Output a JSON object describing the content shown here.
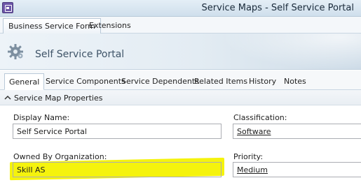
{
  "window": {
    "title": "Service Maps - Self Service Portal"
  },
  "form_tabs": [
    {
      "label": "Business Service Form",
      "active": true
    },
    {
      "label": "Extensions",
      "active": false
    }
  ],
  "banner": {
    "title": "Self Service Portal",
    "icon": "gear-icon"
  },
  "section_tabs": [
    {
      "label": "General",
      "active": true
    },
    {
      "label": "Service Components",
      "active": false
    },
    {
      "label": "Service Dependents",
      "active": false
    },
    {
      "label": "Related Items",
      "active": false
    },
    {
      "label": "History",
      "active": false
    },
    {
      "label": "Notes",
      "active": false
    }
  ],
  "group": {
    "title": "Service Map Properties"
  },
  "fields": {
    "display_name": {
      "label": "Display Name:",
      "value": "Self Service Portal"
    },
    "classification": {
      "label": "Classification:",
      "value": "Software"
    },
    "owned_by": {
      "label": "Owned By Organization:",
      "value": "Skill AS"
    },
    "priority": {
      "label": "Priority:",
      "value": "Medium"
    }
  },
  "colors": {
    "highlight": "#f4f200",
    "accent": "#6c55a8"
  }
}
